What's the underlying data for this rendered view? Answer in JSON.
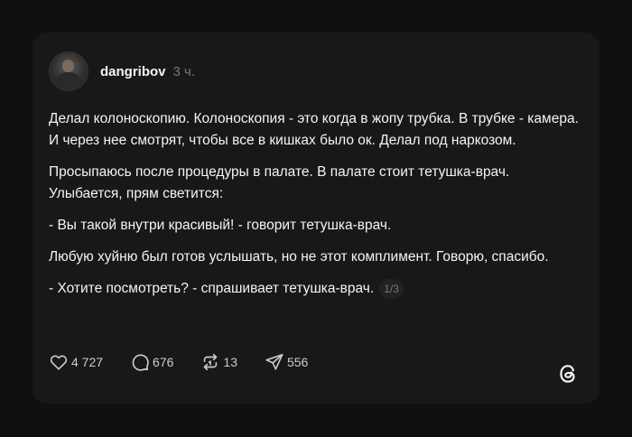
{
  "post": {
    "username": "dangribov",
    "time": "3 ч.",
    "paragraphs": [
      "Делал колоноскопию. Колоноскопия - это когда в жопу трубка. В трубке - камера. И через нее смотрят, чтобы все в кишках было ок. Делал под наркозом.",
      "Просыпаюсь после процедуры в палате. В палате стоит тетушка-врач. Улыбается, прям светится:",
      "- Вы такой внутри красивый! - говорит тетушка-врач.",
      "Любую хуйню был готов услышать, но не этот комплимент. Говорю, спасибо.",
      "- Хотите посмотреть? - спрашивает тетушка-врач."
    ],
    "pager": "1/3"
  },
  "actions": {
    "likes": "4 727",
    "comments": "676",
    "reposts": "13",
    "shares": "556"
  },
  "icons": {
    "like": "heart-icon",
    "comment": "comment-icon",
    "repost": "repost-icon",
    "share": "send-icon",
    "brand": "threads-logo-icon"
  },
  "colors": {
    "background": "#101010",
    "card": "#181818",
    "text": "#f3f5f7",
    "muted": "#777777"
  }
}
